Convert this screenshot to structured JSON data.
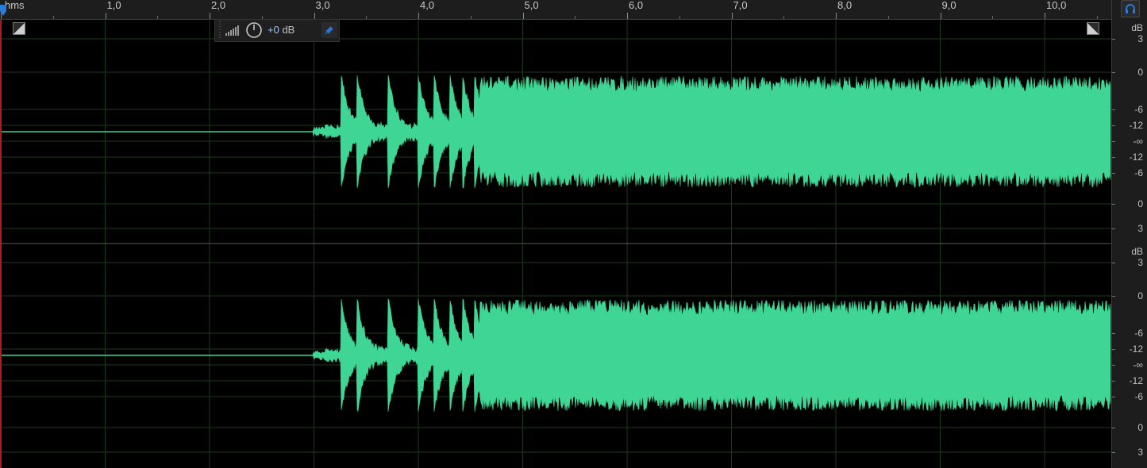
{
  "ruler": {
    "unit_label": "hms",
    "time_labels": [
      "1,0",
      "2,0",
      "3,0",
      "4,0",
      "5,0",
      "6,0",
      "7,0",
      "8,0",
      "9,0",
      "10,0"
    ]
  },
  "hud": {
    "gain_value": "+0",
    "gain_unit": "dB"
  },
  "channels": [
    {
      "db_unit": "dB",
      "db_labels": [
        "3",
        "0",
        "-6",
        "-12",
        "-∞",
        "-12",
        "-6",
        "0",
        "3"
      ]
    },
    {
      "db_unit": "dB",
      "db_labels": [
        "3",
        "0",
        "-6",
        "-12",
        "-∞",
        "-12",
        "-6",
        "0",
        "3"
      ]
    }
  ],
  "colors": {
    "waveform": "#3fd695",
    "background": "#000000",
    "gridline": "#1c3a1c",
    "playhead_line": "#b51a1a",
    "accent": "#2a7bd5"
  },
  "icons": {
    "corner_left": "fade-in-icon",
    "corner_right": "fade-out-icon",
    "pin": "pin-icon",
    "headphone": "headphone-icon",
    "meter": "level-meter-icon",
    "knob": "gain-knob-icon"
  }
}
